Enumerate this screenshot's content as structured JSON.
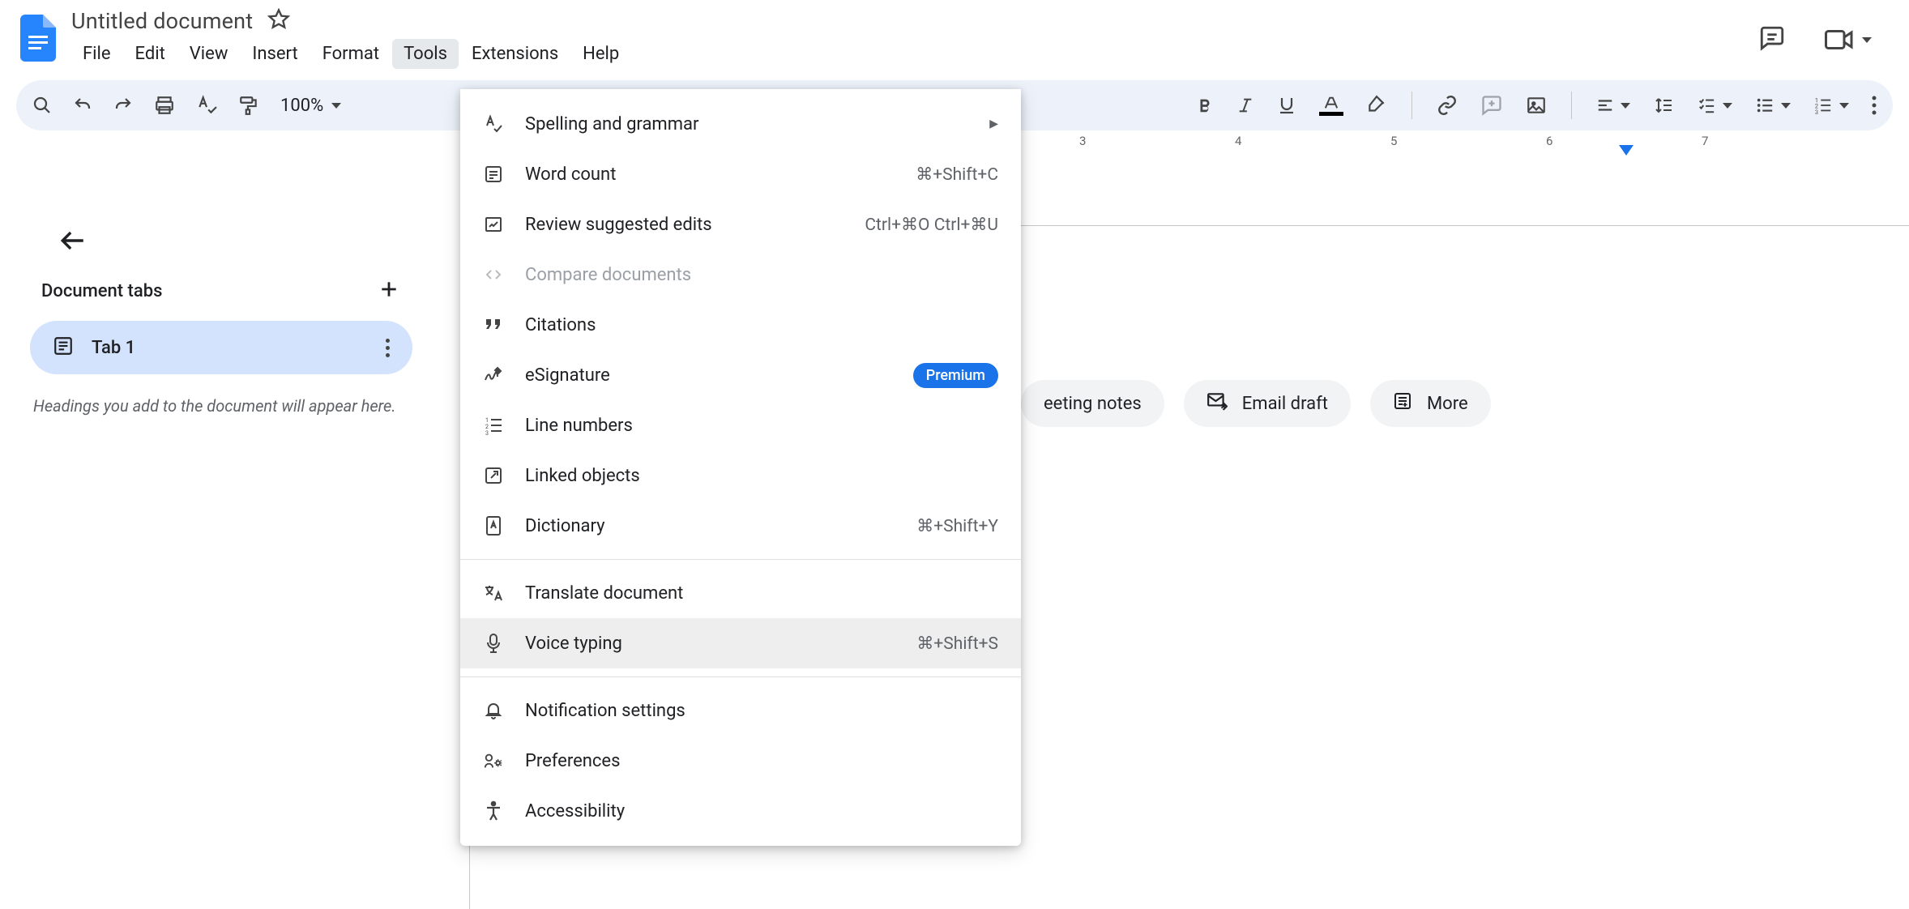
{
  "doc": {
    "title": "Untitled document"
  },
  "menus": {
    "file": "File",
    "edit": "Edit",
    "view": "View",
    "insert": "Insert",
    "format": "Format",
    "tools": "Tools",
    "extensions": "Extensions",
    "help": "Help"
  },
  "toolbar": {
    "zoom": "100%"
  },
  "sidebar": {
    "title": "Document tabs",
    "tab1": "Tab 1",
    "hint": "Headings you add to the document will appear here."
  },
  "chips": {
    "meeting": "eeting notes",
    "email": "Email draft",
    "more": "More"
  },
  "tools_menu": {
    "spelling": "Spelling and grammar",
    "wordcount": "Word count",
    "wordcount_sc": "⌘+Shift+C",
    "review": "Review suggested edits",
    "review_sc": "Ctrl+⌘O Ctrl+⌘U",
    "compare": "Compare documents",
    "citations": "Citations",
    "esig": "eSignature",
    "esig_badge": "Premium",
    "linenum": "Line numbers",
    "linked": "Linked objects",
    "dict": "Dictionary",
    "dict_sc": "⌘+Shift+Y",
    "translate": "Translate document",
    "voice": "Voice typing",
    "voice_sc": "⌘+Shift+S",
    "notif": "Notification settings",
    "prefs": "Preferences",
    "a11y": "Accessibility"
  },
  "ruler": {
    "n3": "3",
    "n4": "4",
    "n5": "5",
    "n6": "6",
    "n7": "7"
  }
}
